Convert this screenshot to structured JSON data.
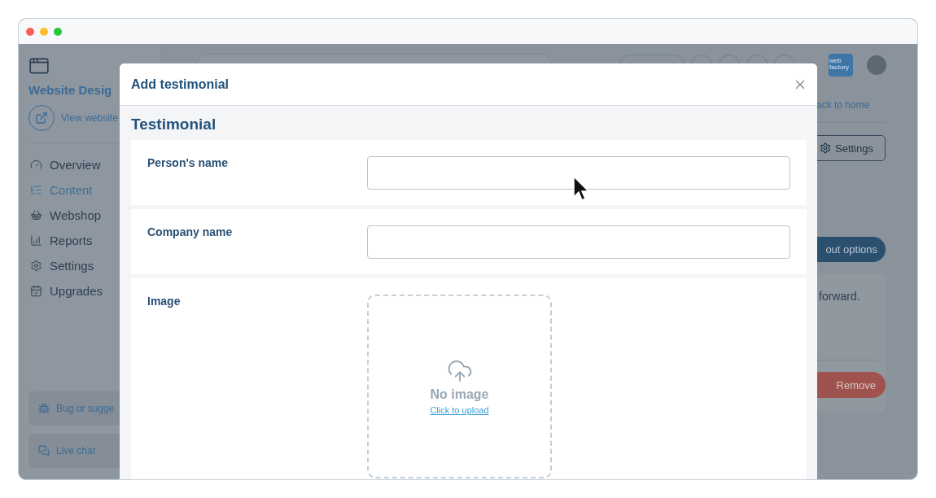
{
  "sidebar": {
    "title": "Website Desig",
    "view_link": "View website",
    "items": [
      {
        "label": "Overview",
        "selected": false
      },
      {
        "label": "Content",
        "selected": true
      },
      {
        "label": "Webshop",
        "selected": false
      },
      {
        "label": "Reports",
        "selected": false
      },
      {
        "label": "Settings",
        "selected": false
      },
      {
        "label": "Upgrades",
        "selected": false
      }
    ],
    "footer": [
      {
        "label": "Bug or sugge"
      },
      {
        "label": "Live chat"
      }
    ]
  },
  "header": {
    "logo_text": "web factory"
  },
  "background": {
    "back_link": "ack to home",
    "settings_button": "Settings",
    "options_button": "out options",
    "card_text": "forward.",
    "remove_button": "Remove"
  },
  "modal": {
    "title": "Add testimonial",
    "section_title": "Testimonial",
    "fields": [
      {
        "kind": "text",
        "label": "Person's name"
      },
      {
        "kind": "text",
        "label": "Company name"
      },
      {
        "kind": "image",
        "label": "Image",
        "empty_text": "No image",
        "upload_link": "Click to upload"
      }
    ]
  }
}
